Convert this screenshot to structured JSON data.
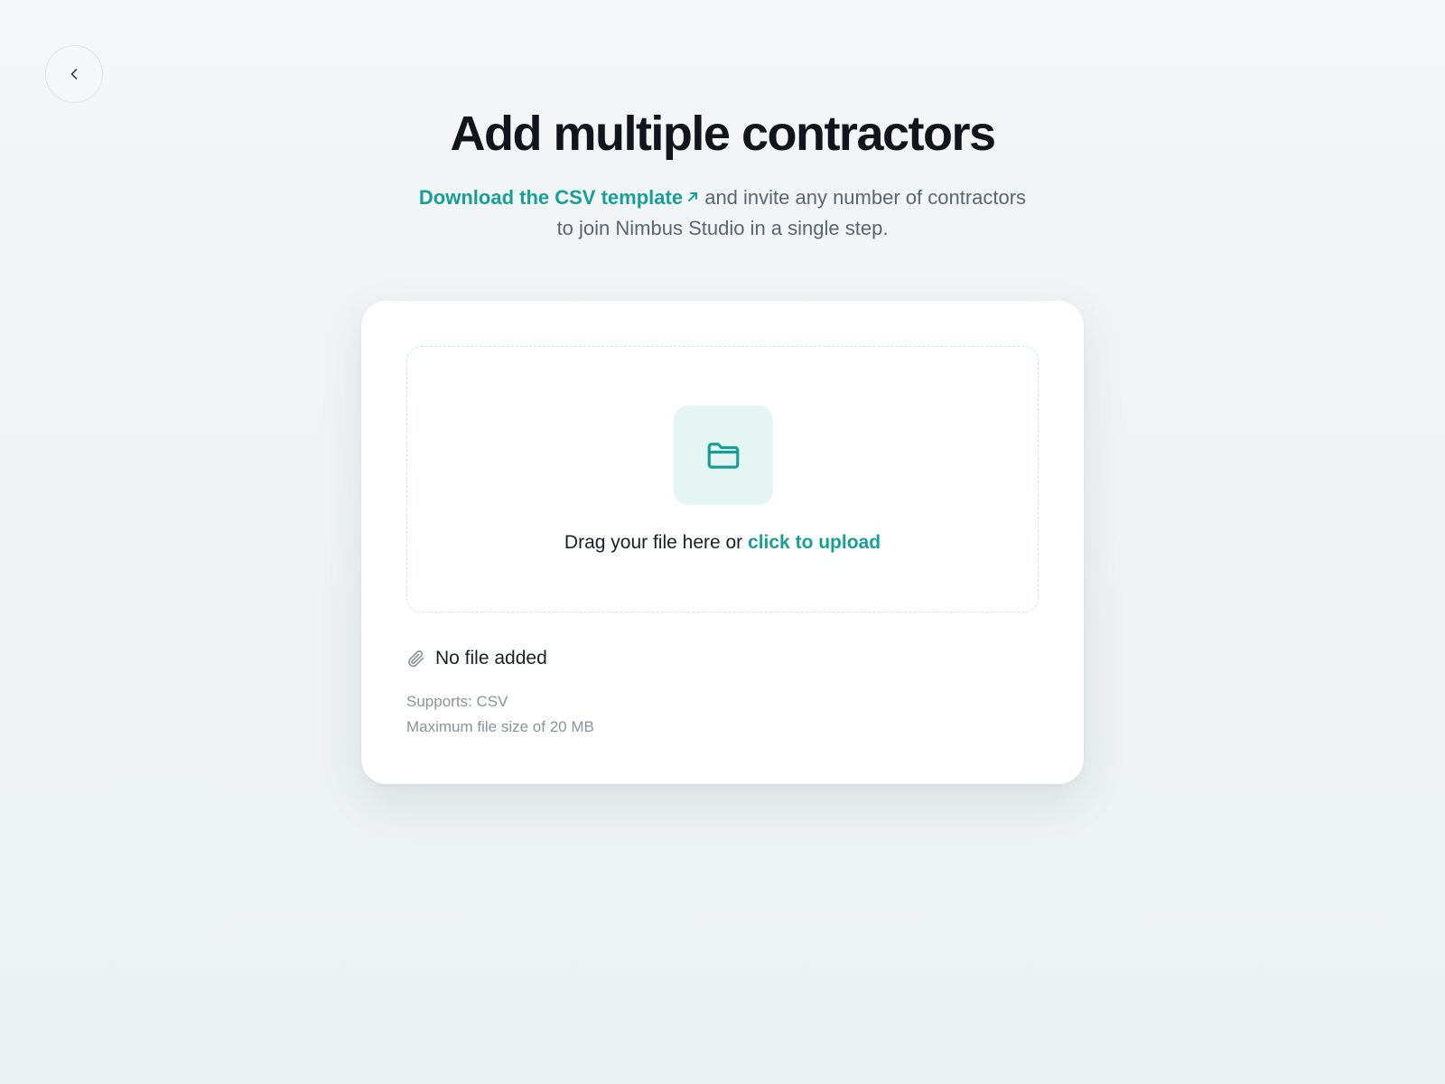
{
  "nav": {
    "back_icon": "chevron-left-icon"
  },
  "header": {
    "title": "Add multiple contractors",
    "csv_link_label": "Download the CSV template",
    "csv_link_icon": "external-arrow-icon",
    "subtitle_line1": "and invite any number of contractors",
    "subtitle_line2": "to join Nimbus Studio in a single step."
  },
  "upload": {
    "folder_icon": "folder-icon",
    "drag_text": "Drag your file here or",
    "click_label": "click to upload"
  },
  "file": {
    "icon": "paperclip-icon",
    "status": "No file added"
  },
  "requirements": {
    "supports": "Supports: CSV",
    "max_size": "Maximum file size of 20 MB"
  },
  "colors": {
    "accent": "#179e96",
    "accent_bg": "#e5f5f3",
    "title": "#12161c",
    "muted": "#8b9299"
  }
}
